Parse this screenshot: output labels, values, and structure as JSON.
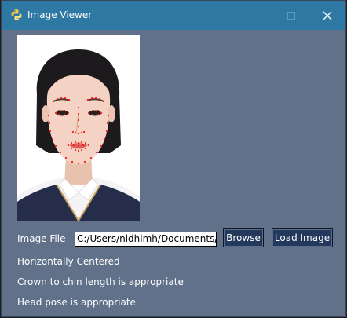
{
  "window": {
    "title": "Image Viewer",
    "icon": "python-icon",
    "controls": {
      "minimize_icon": "minimize-icon",
      "maximize_icon": "maximize-icon",
      "close_icon": "close-icon"
    }
  },
  "image": {
    "description_icon": "portrait-photo",
    "landmarks_color": "#ff1a1a"
  },
  "form": {
    "image_file_label": "Image File",
    "image_file_value": "C:/Users/nidhimh/Documents/c",
    "browse_label": "Browse",
    "load_label": "Load Image"
  },
  "status": {
    "line1": "Horizontally Centered",
    "line2": "Crown to chin length is appropriate",
    "line3": "Head pose is appropriate"
  },
  "colors": {
    "titlebar": "#2e79a3",
    "window_bg": "#607189",
    "button_bg": "#24385c"
  }
}
